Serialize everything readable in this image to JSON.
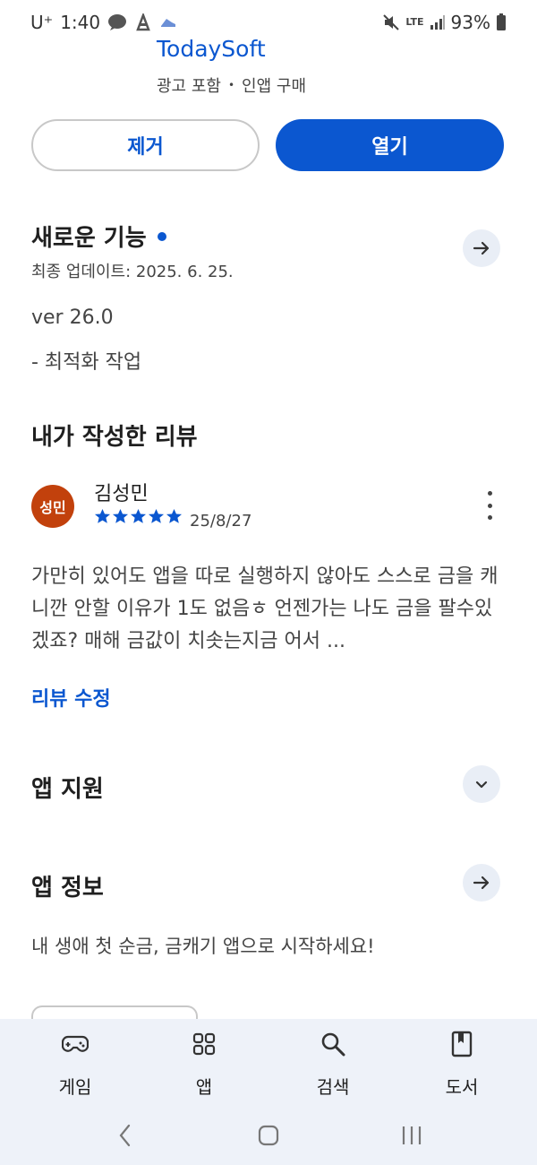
{
  "status_bar": {
    "carrier": "U⁺",
    "time": "1:40",
    "network": "LTE",
    "battery": "93%"
  },
  "app": {
    "title": "TodaySoft",
    "meta_ads": "광고 포함",
    "meta_separator": "•",
    "meta_iap": "인앱 구매"
  },
  "buttons": {
    "remove": "제거",
    "open": "열기"
  },
  "whats_new": {
    "title": "새로운 기능",
    "last_updated": "최종 업데이트: 2025. 6. 25.",
    "version": "ver 26.0",
    "note": "- 최적화 작업"
  },
  "my_review": {
    "title": "내가 작성한 리뷰",
    "avatar_text": "성민",
    "reviewer": "김성민",
    "rating": 5,
    "date": "25/8/27",
    "text": "가만히 있어도 앱을 따로 실행하지 않아도 스스로 금을 캐니깐 안할 이유가 1도 없음ㅎ 언젠가는 나도 금을 팔수있겠죠? 매해 금값이 치솟는지금 어서 ...",
    "edit_label": "리뷰 수정"
  },
  "app_support": {
    "title": "앱 지원"
  },
  "app_info": {
    "title": "앱 정보",
    "description": "내 생애 첫 순금, 금캐기 앱으로 시작하세요!"
  },
  "bottom_nav": {
    "items": [
      {
        "label": "게임",
        "icon": "gamepad-icon"
      },
      {
        "label": "앱",
        "icon": "apps-grid-icon"
      },
      {
        "label": "검색",
        "icon": "search-icon"
      },
      {
        "label": "도서",
        "icon": "book-icon"
      }
    ]
  },
  "colors": {
    "accent": "#0b57d0",
    "avatar": "#c2410c",
    "chip_bg": "#e9eef6",
    "nav_bg": "#eef2f9"
  }
}
